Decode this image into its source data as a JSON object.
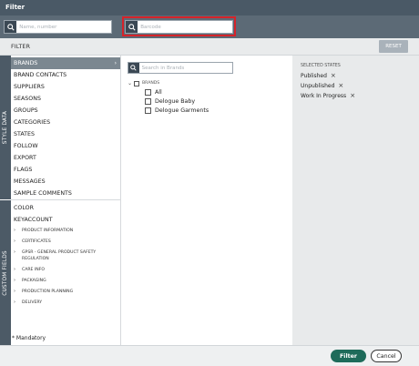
{
  "window": {
    "title": "Filter"
  },
  "search": {
    "name_placeholder": "Name, number",
    "barcode_placeholder": "Barcode"
  },
  "filterbar": {
    "label": "FILTER",
    "reset_label": "RESET"
  },
  "tabs": {
    "style_data": "STYLE DATA",
    "custom_fields": "CUSTOM FIELDS"
  },
  "style_data_items": [
    "BRANDS",
    "BRAND CONTACTS",
    "SUPPLIERS",
    "SEASONS",
    "GROUPS",
    "CATEGORIES",
    "STATES",
    "FOLLOW",
    "EXPORT",
    "FLAGS",
    "MESSAGES",
    "SAMPLE COMMENTS"
  ],
  "custom_field_items": [
    "COLOR",
    "KEYACCOUNT"
  ],
  "custom_field_groups": [
    "PRODUCT INFORMATION",
    "CERTIFICATES",
    "GPSR - GENERAL PRODUCT SAFETY",
    "REGULATION",
    "CARE INFO",
    "PACKAGING",
    "PRODUCTION PLANNING",
    "DELIVERY"
  ],
  "mandatory_note": "* Mandatory",
  "brands_panel": {
    "search_placeholder": "Search in Brands",
    "root_label": "BRANDS",
    "items": [
      "All",
      "Delogue Baby",
      "Delogue Garments"
    ]
  },
  "selected_states": {
    "title": "SELECTED STATES",
    "items": [
      "Published",
      "Unpublished",
      "Work In Progress"
    ]
  },
  "footer": {
    "filter_label": "Filter",
    "cancel_label": "Cancel"
  },
  "colors": {
    "accent": "#1e6b5a",
    "header": "#4a5966",
    "highlight": "#d6232a"
  }
}
